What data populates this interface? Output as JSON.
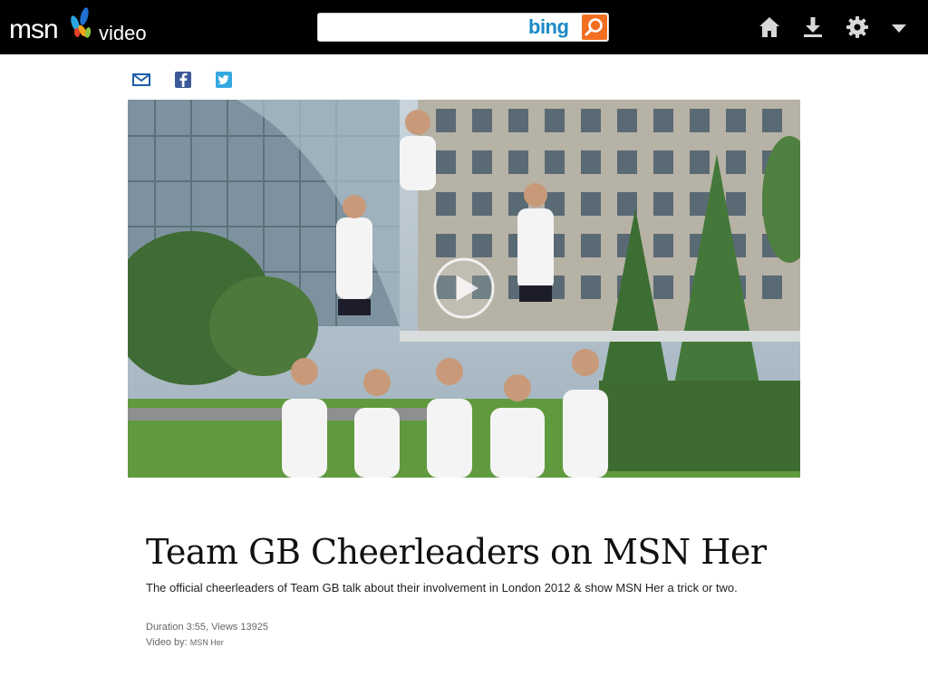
{
  "header": {
    "brand": "msn",
    "section": "video",
    "search": {
      "value": "",
      "placeholder": "",
      "engine_label": "bing"
    },
    "icons": [
      "home-icon",
      "download-icon",
      "gear-icon",
      "chevron-down-icon"
    ]
  },
  "share": {
    "icons": [
      "mail-icon",
      "facebook-icon",
      "twitter-icon"
    ]
  },
  "video": {
    "title": "Team GB Cheerleaders on MSN Her",
    "description": "The official cheerleaders of Team GB talk about their involvement in London 2012 & show MSN Her a trick or two.",
    "duration_views": "Duration 3:55, Views 13925",
    "video_by_label": "Video by:",
    "source": "MSN Her"
  },
  "colors": {
    "topbar": "#000000",
    "bing_blue": "#1b8ac7",
    "bing_orange": "#f26f21",
    "share_blue": "#1e5fa8",
    "facebook": "#3b5998",
    "twitter": "#33a8e0"
  }
}
